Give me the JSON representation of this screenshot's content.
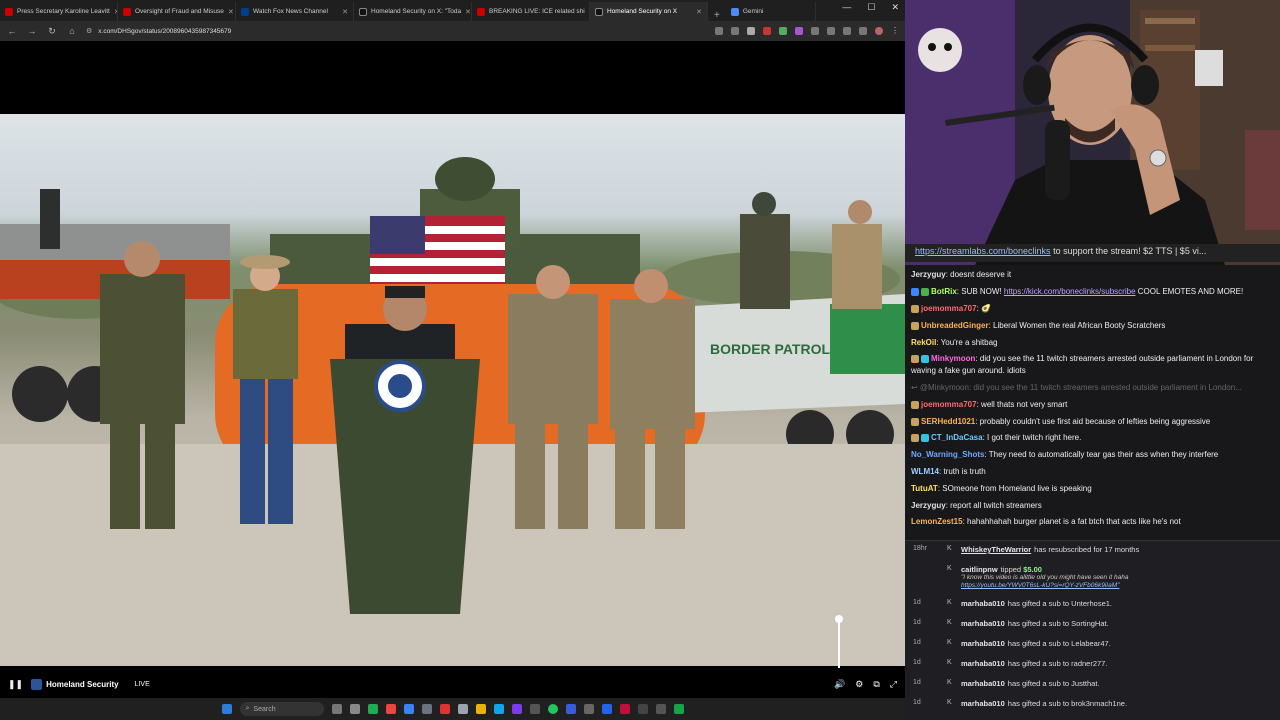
{
  "browser": {
    "tabs": [
      {
        "label": "Press Secretary Karoline Leavitt",
        "active": false
      },
      {
        "label": "Oversight of Fraud and Misuse",
        "active": false
      },
      {
        "label": "Watch Fox News Channel",
        "active": false
      },
      {
        "label": "Homeland Security on X: \"Toda",
        "active": false
      },
      {
        "label": "BREAKING LIVE: ICE related shi",
        "active": false
      },
      {
        "label": "Homeland Security on X",
        "active": true
      },
      {
        "label": "Gemini",
        "active": false
      }
    ],
    "url": "x.com/DHSgov/status/2008960435987345679",
    "window_controls": [
      "—",
      "☐",
      "✕"
    ]
  },
  "video": {
    "channel_name": "Homeland Security",
    "status": "LIVE",
    "podium_seal": "Department of Homeland Security",
    "boat_text": "BORDER PATROL"
  },
  "taskbar": {
    "search_placeholder": "Search"
  },
  "stream": {
    "ticker_link": "https://streamlabs.com/boneclinks",
    "ticker_text": "to support the stream! $2 TTS | $5 vi..."
  },
  "chat": {
    "messages": [
      {
        "user": "Jerzyguy",
        "color": "#e0e0e0",
        "text": "doesnt deserve it",
        "badges": []
      },
      {
        "user": "BotRix",
        "color": "#b3ff66",
        "text": "SUB NOW! ",
        "link": "https://kick.com/boneclinks/subscribe",
        "after": " COOL EMOTES AND MORE!",
        "badges": [
          "#3a86ff",
          "#4caf50"
        ]
      },
      {
        "user": "joemomma707",
        "color": "#ff6a6a",
        "text": "",
        "badges": [
          "#c8a25a"
        ]
      },
      {
        "user": "UnbreadedGinger",
        "color": "#ffb347",
        "text": "Liberal Women the real African Booty Scratchers",
        "badges": [
          "#c8a25a"
        ]
      },
      {
        "user": "RekOil",
        "color": "#ffe066",
        "text": "You're a shitbag",
        "badges": []
      },
      {
        "user": "Minkymoon",
        "color": "#ff6adf",
        "text": "did you see the 11 twitch streamers arrested outside parliament in London for waving a fake gun around. idiots",
        "badges": [
          "#c8a25a",
          "#2ec4e6"
        ]
      },
      {
        "user": "",
        "color": "#666",
        "text": "↩ @Minkymoon: did you see the 11 twitch streamers arrested outside parliament in London...",
        "badges": [],
        "deleted": true
      },
      {
        "user": "joemomma707",
        "color": "#ff6a6a",
        "text": "well thats not very smart",
        "badges": [
          "#c8a25a"
        ]
      },
      {
        "user": "SERHedd1021",
        "color": "#ffb347",
        "text": "probably couldn't use first aid because of lefties being aggressive",
        "badges": [
          "#c8a25a"
        ]
      },
      {
        "user": "CT_InDaCasa",
        "color": "#66ccff",
        "text": "I got their twitch right here.",
        "badges": [
          "#c8a25a",
          "#2ec4e6"
        ]
      },
      {
        "user": "No_Warning_Shots",
        "color": "#6fa8ff",
        "text": "They need to automatically tear gas their ass when they interfere",
        "badges": []
      },
      {
        "user": "WLM14",
        "color": "#9ad0ff",
        "text": "truth is truth",
        "badges": []
      },
      {
        "user": "TutuAT",
        "color": "#ffe066",
        "text": "SOmeone from Homeland live is speaking",
        "badges": []
      },
      {
        "user": "Jerzyguy",
        "color": "#e0e0e0",
        "text": "report all twitch streamers",
        "badges": []
      },
      {
        "user": "LemonZest15",
        "color": "#ffb347",
        "text": "hahahhahah burger planet is a fat btch that acts like he's not",
        "badges": []
      }
    ]
  },
  "events": [
    {
      "time": "18hr",
      "name": "WhiskeyTheWarrior",
      "text": "has resubscribed for 17 months",
      "underline": true
    },
    {
      "time": "",
      "name": "caitlinpnw",
      "text": "tipped",
      "amount": "$5.00",
      "quote": "\"I know this video is alittle old you might have seen it haha",
      "quote_link": "https://youtu.be/YWV0T6sL-kU?si=rQY-zVFb06k9iIaM\""
    },
    {
      "time": "1d",
      "name": "marhaba010",
      "text": "has gifted a sub to Unterhose1."
    },
    {
      "time": "1d",
      "name": "marhaba010",
      "text": "has gifted a sub to SortingHat."
    },
    {
      "time": "1d",
      "name": "marhaba010",
      "text": "has gifted a sub to Lelabear47."
    },
    {
      "time": "1d",
      "name": "marhaba010",
      "text": "has gifted a sub to radner277."
    },
    {
      "time": "1d",
      "name": "marhaba010",
      "text": "has gifted a sub to Justthat."
    },
    {
      "time": "1d",
      "name": "marhaba010",
      "text": "has gifted a sub to brok3nmach1ne."
    }
  ]
}
